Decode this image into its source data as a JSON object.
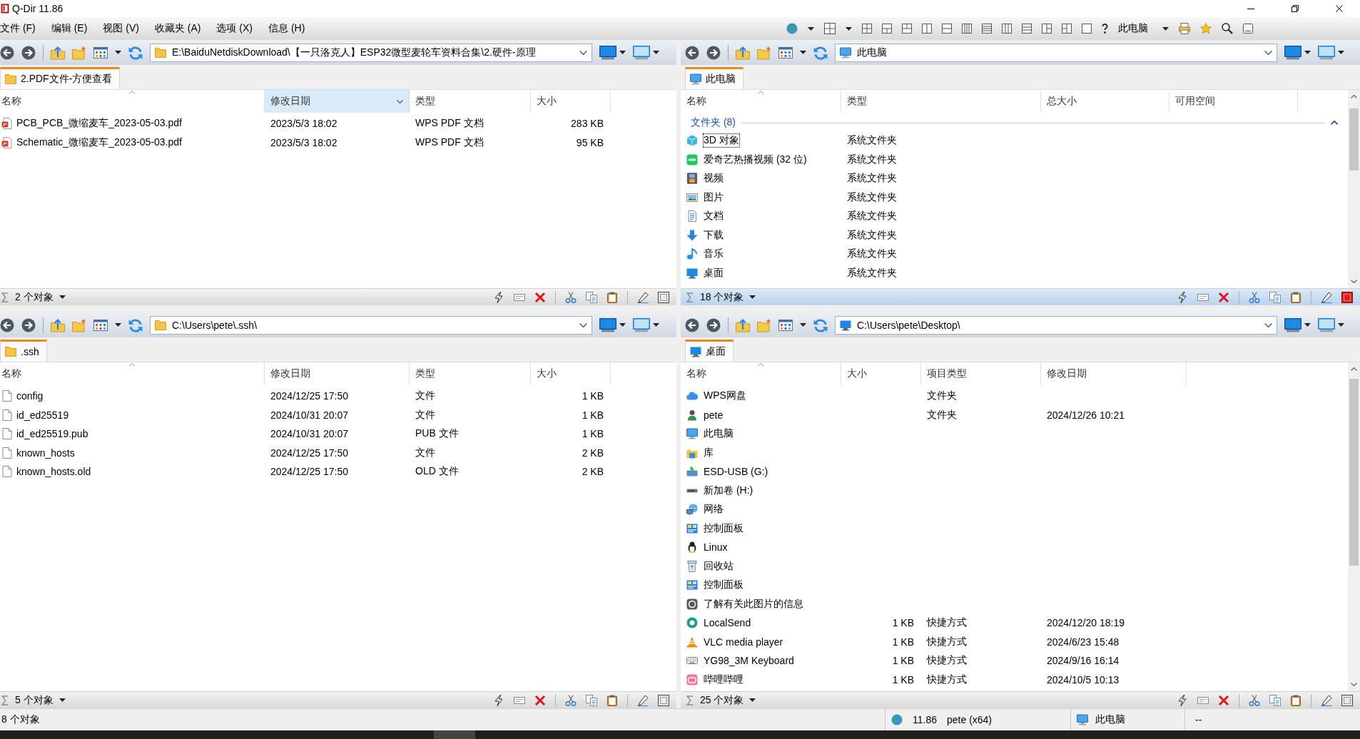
{
  "window": {
    "title": "Q-Dir 11.86"
  },
  "menu": [
    "文件 (F)",
    "编辑 (E)",
    "视图 (V)",
    "收藏夹 (A)",
    "选项 (X)",
    "信息 (H)"
  ],
  "toolbar": {
    "location": "此电脑"
  },
  "panes": [
    {
      "active": false,
      "scrollable": false,
      "address": {
        "kind": "folder",
        "text": "E:\\BaiduNetdiskDownload\\【一只洛克人】ESP32微型麦轮车资料合集\\2.硬件-原理"
      },
      "tab": {
        "kind": "folder",
        "label": "2.PDF文件-方便查看",
        "selected": true
      },
      "columns": [
        {
          "label": "名称",
          "kind": "text",
          "sorted": true,
          "hovered": false
        },
        {
          "label": "修改日期",
          "kind": "text",
          "sorted": false,
          "hovered": true
        },
        {
          "label": "类型",
          "kind": "text",
          "sorted": false,
          "hovered": false
        },
        {
          "label": "大小",
          "kind": "number",
          "sorted": false,
          "hovered": false
        }
      ],
      "rows": [
        {
          "kind": "pdf",
          "cells": [
            "PCB_PCB_微缩麦车_2023-05-03.pdf",
            "2023/5/3 18:02",
            "WPS PDF 文档",
            "283 KB"
          ]
        },
        {
          "kind": "pdf",
          "cells": [
            "Schematic_微缩麦车_2023-05-03.pdf",
            "2023/5/3 18:02",
            "WPS PDF 文档",
            "95 KB"
          ]
        }
      ],
      "status": "2 个对象"
    },
    {
      "active": true,
      "scrollable": true,
      "address": {
        "kind": "computer",
        "text": "此电脑"
      },
      "tab": {
        "kind": "computer",
        "label": "此电脑",
        "selected": true
      },
      "columns": [
        {
          "label": "名称",
          "sorted": true,
          "hovered": false
        },
        {
          "label": "类型",
          "sorted": false,
          "hovered": false
        },
        {
          "label": "总大小",
          "sorted": false,
          "hovered": false
        },
        {
          "label": "可用空间",
          "sorted": false,
          "hovered": false
        }
      ],
      "groups": [
        {
          "label": "文件夹 (8)",
          "expanded": true,
          "rows": [
            {
              "kind": "cube",
              "focused": true,
              "cells": [
                "3D 对象",
                "系统文件夹"
              ]
            },
            {
              "kind": "iqiyi",
              "focused": false,
              "cells": [
                "爱奇艺热播视频 (32 位)",
                "系统文件夹"
              ]
            },
            {
              "kind": "video",
              "focused": false,
              "cells": [
                "视频",
                "系统文件夹"
              ]
            },
            {
              "kind": "pictures",
              "focused": false,
              "cells": [
                "图片",
                "系统文件夹"
              ]
            },
            {
              "kind": "documents",
              "focused": false,
              "cells": [
                "文档",
                "系统文件夹"
              ]
            },
            {
              "kind": "download",
              "focused": false,
              "cells": [
                "下载",
                "系统文件夹"
              ]
            },
            {
              "kind": "music",
              "focused": false,
              "cells": [
                "音乐",
                "系统文件夹"
              ]
            },
            {
              "kind": "desktop",
              "focused": false,
              "cells": [
                "桌面",
                "系统文件夹"
              ]
            }
          ]
        }
      ],
      "status": "18 个对象"
    },
    {
      "active": false,
      "scrollable": false,
      "address": {
        "kind": "folder",
        "text": "C:\\Users\\pete\\.ssh\\"
      },
      "tab": {
        "kind": "folder",
        "label": ".ssh",
        "selected": true
      },
      "columns": [
        {
          "label": "名称",
          "kind": "text",
          "sorted": true,
          "hovered": false
        },
        {
          "label": "修改日期",
          "kind": "text",
          "sorted": false,
          "hovered": false
        },
        {
          "label": "类型",
          "kind": "text",
          "sorted": false,
          "hovered": false
        },
        {
          "label": "大小",
          "kind": "number",
          "sorted": false,
          "hovered": false
        }
      ],
      "rows": [
        {
          "kind": "file",
          "cells": [
            "config",
            "2024/12/25 17:50",
            "文件",
            "1 KB"
          ]
        },
        {
          "kind": "file",
          "cells": [
            "id_ed25519",
            "2024/10/31 20:07",
            "文件",
            "1 KB"
          ]
        },
        {
          "kind": "file",
          "cells": [
            "id_ed25519.pub",
            "2024/10/31 20:07",
            "PUB 文件",
            "1 KB"
          ]
        },
        {
          "kind": "file",
          "cells": [
            "known_hosts",
            "2024/12/25 17:50",
            "文件",
            "2 KB"
          ]
        },
        {
          "kind": "file",
          "cells": [
            "known_hosts.old",
            "2024/12/25 17:50",
            "OLD 文件",
            "2 KB"
          ]
        }
      ],
      "status": "5 个对象"
    },
    {
      "active": false,
      "scrollable": true,
      "address": {
        "kind": "desktop",
        "text": "C:\\Users\\pete\\Desktop\\"
      },
      "tab": {
        "kind": "desktop",
        "label": "桌面",
        "selected": true
      },
      "columns": [
        {
          "label": "名称",
          "kind": "text",
          "sorted": true,
          "hovered": false
        },
        {
          "label": "大小",
          "kind": "number",
          "sorted": false,
          "hovered": false
        },
        {
          "label": "项目类型",
          "kind": "text",
          "sorted": false,
          "hovered": false
        },
        {
          "label": "修改日期",
          "kind": "text",
          "sorted": false,
          "hovered": false
        }
      ],
      "rows": [
        {
          "kind": "cloud",
          "cells": [
            "WPS网盘",
            null,
            "文件夹"
          ]
        },
        {
          "kind": "user",
          "cells": [
            "pete",
            null,
            "文件夹",
            "2024/12/26 10:21"
          ]
        },
        {
          "kind": "computer",
          "cells": [
            "此电脑"
          ]
        },
        {
          "kind": "library",
          "cells": [
            "库"
          ]
        },
        {
          "kind": "usb-drive",
          "cells": [
            "ESD-USB (G:)"
          ]
        },
        {
          "kind": "drive",
          "cells": [
            "新加卷 (H:)"
          ]
        },
        {
          "kind": "network",
          "cells": [
            "网络"
          ]
        },
        {
          "kind": "control-panel",
          "cells": [
            "控制面板"
          ]
        },
        {
          "kind": "linux",
          "cells": [
            "Linux"
          ]
        },
        {
          "kind": "recycle-bin",
          "cells": [
            "回收站"
          ]
        },
        {
          "kind": "control-panel",
          "cells": [
            "控制面板"
          ]
        },
        {
          "kind": "info",
          "cells": [
            "了解有关此图片的信息"
          ]
        },
        {
          "kind": "localsend",
          "cells": [
            "LocalSend",
            "1 KB",
            "快捷方式",
            "2024/12/20 18:19"
          ]
        },
        {
          "kind": "vlc",
          "cells": [
            "VLC media player",
            "1 KB",
            "快捷方式",
            "2024/6/23 15:48"
          ]
        },
        {
          "kind": "keyboard",
          "cells": [
            "YG98_3M Keyboard",
            "1 KB",
            "快捷方式",
            "2024/9/16 16:14"
          ]
        },
        {
          "kind": "bilibili",
          "cells": [
            "哔哩哔哩",
            "1 KB",
            "快捷方式",
            "2024/10/5 10:13"
          ]
        }
      ],
      "status": "25 个对象"
    }
  ],
  "status_bar": {
    "summary": "8 个对象",
    "version": "11.86",
    "user": "pete (x64)",
    "location": "此电脑",
    "extra": "--"
  }
}
